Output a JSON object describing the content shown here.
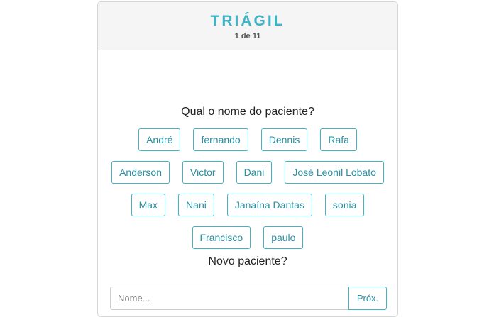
{
  "header": {
    "brand": "TRIÁGIL",
    "step": "1 de 11"
  },
  "main": {
    "question": "Qual o nome do paciente?",
    "name_rows": [
      [
        "André",
        "fernando",
        "Dennis",
        "Rafa"
      ],
      [
        "Anderson",
        "Victor",
        "Dani",
        "José Leonil Lobato"
      ],
      [
        "Max",
        "Nani",
        "Janaína Dantas",
        "sonia"
      ],
      [
        "Francisco",
        "paulo"
      ]
    ],
    "new_patient_label": "Novo paciente?",
    "name_input": {
      "placeholder": "Nome...",
      "value": ""
    },
    "next_label": "Próx."
  },
  "colors": {
    "accent": "#3fb4c6",
    "header_bg": "#f5f5f5"
  }
}
